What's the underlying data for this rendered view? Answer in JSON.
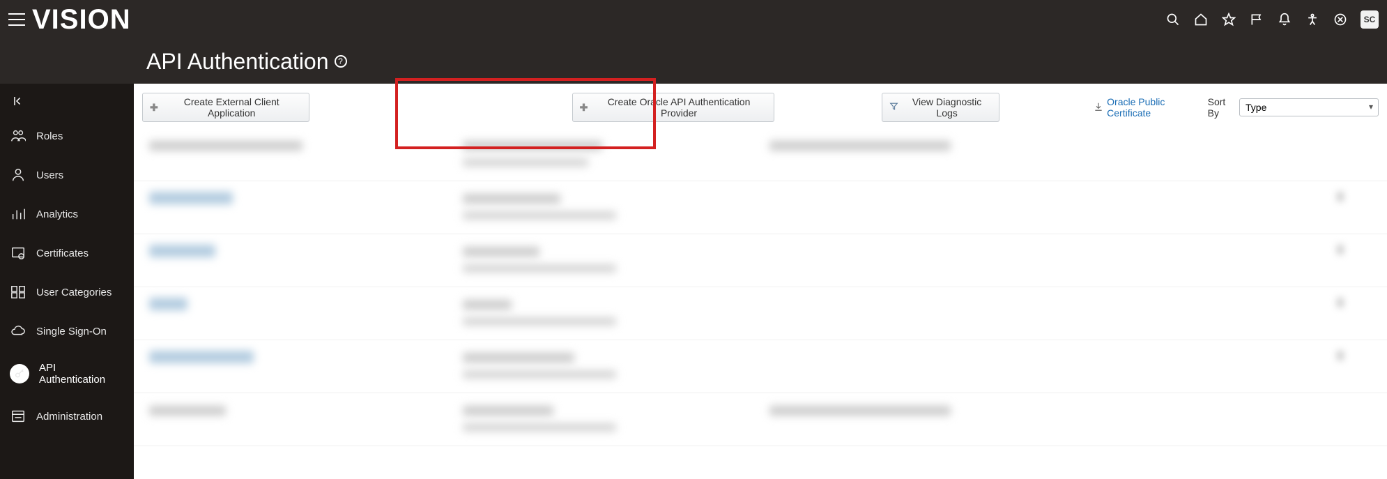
{
  "topbar": {
    "logo": "VISION",
    "avatar": "SC"
  },
  "header": {
    "title": "API Authentication"
  },
  "sidebar": {
    "items": [
      {
        "label": "Roles"
      },
      {
        "label": "Users"
      },
      {
        "label": "Analytics"
      },
      {
        "label": "Certificates"
      },
      {
        "label": "User Categories"
      },
      {
        "label": "Single Sign-On"
      },
      {
        "label": "API Authentication"
      },
      {
        "label": "Administration"
      }
    ]
  },
  "toolbar": {
    "btn_create_client": "Create External Client Application",
    "btn_create_provider": "Create Oracle API Authentication Provider",
    "btn_view_logs": "View Diagnostic Logs",
    "link_cert": "Oracle Public Certificate",
    "sort_by_label": "Sort By",
    "sort_value": "Type"
  }
}
